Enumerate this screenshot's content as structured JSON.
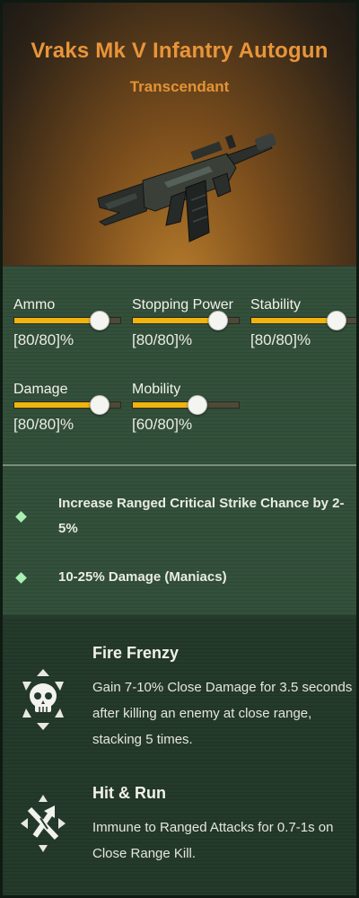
{
  "weapon": {
    "name": "Vraks Mk V Infantry Autogun",
    "rarity": "Transcendant",
    "image_icon": "autogun-rifle-icon"
  },
  "stats": [
    {
      "label": "Ammo",
      "value": "[80/80]%",
      "fill": 0.8
    },
    {
      "label": "Stopping Power",
      "value": "[80/80]%",
      "fill": 0.8
    },
    {
      "label": "Stability",
      "value": "[80/80]%",
      "fill": 0.8
    },
    {
      "label": "Damage",
      "value": "[80/80]%",
      "fill": 0.8
    },
    {
      "label": "Mobility",
      "value": "[60/80]%",
      "fill": 0.6
    }
  ],
  "perks": [
    {
      "text": "Increase Ranged Critical Strike Chance by 2-5%"
    },
    {
      "text": "10-25% Damage (Maniacs)"
    }
  ],
  "blessings": [
    {
      "name": "Fire Frenzy",
      "description": "Gain 7-10% Close Damage for 3.5 seconds after killing an enemy at close range, stacking 5 times.",
      "icon": "skull-icon"
    },
    {
      "name": "Hit & Run",
      "description": "Immune to Ranged Attacks for 0.7-1s on Close Range Kill.",
      "icon": "crossed-arrows-icon"
    }
  ],
  "colors": {
    "accent": "#e8953a",
    "bar_fill": "#f0b40f",
    "panel": "#33503b"
  }
}
